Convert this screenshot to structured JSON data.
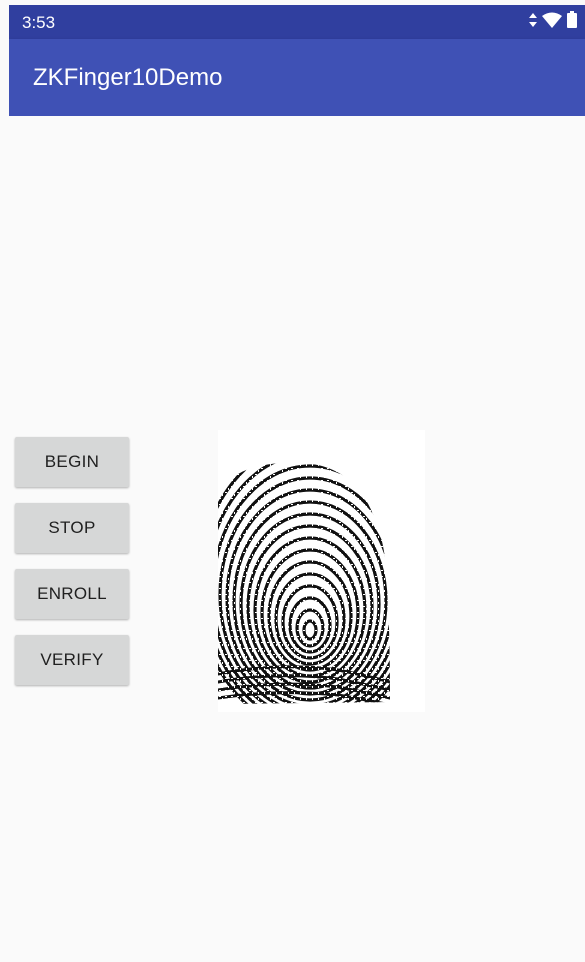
{
  "status_bar": {
    "time": "3:53",
    "icons": [
      "data-arrows-icon",
      "wifi-icon",
      "battery-icon"
    ]
  },
  "app_bar": {
    "title": "ZKFinger10Demo"
  },
  "buttons": {
    "begin": "BEGIN",
    "stop": "STOP",
    "enroll": "ENROLL",
    "verify": "VERIFY"
  },
  "fingerprint_image": {
    "icon": "fingerprint-image"
  },
  "colors": {
    "status_bar": "#303f9f",
    "app_bar": "#3f51b5",
    "background": "#fafafa",
    "button": "#d6d7d7"
  }
}
